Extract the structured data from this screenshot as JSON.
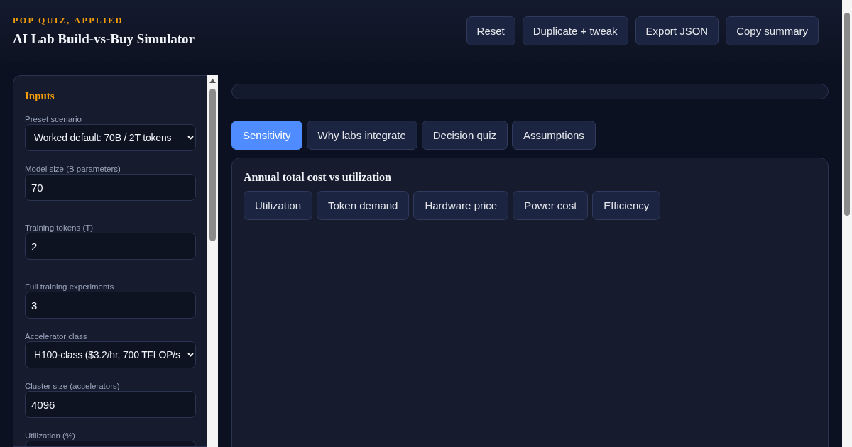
{
  "header": {
    "eyebrow": "POP QUIZ, APPLIED",
    "title": "AI Lab Build-vs-Buy Simulator",
    "actions": [
      "Reset",
      "Duplicate + tweak",
      "Export JSON",
      "Copy summary"
    ]
  },
  "inputs": {
    "title": "Inputs",
    "fields": [
      {
        "kind": "select",
        "label": "Preset scenario",
        "value": "Worked default: 70B / 2T tokens"
      },
      {
        "kind": "number",
        "label": "Model size (B parameters)",
        "value": "70"
      },
      {
        "kind": "number",
        "label": "Training tokens (T)",
        "value": "2"
      },
      {
        "kind": "number",
        "label": "Full training experiments",
        "value": "3"
      },
      {
        "kind": "select",
        "label": "Accelerator class",
        "value": "H100-class ($3.2/hr, 700 TFLOP/s"
      },
      {
        "kind": "number",
        "label": "Cluster size (accelerators)",
        "value": "4096"
      },
      {
        "kind": "number",
        "label": "Utilization (%)"
      }
    ]
  },
  "progress": {
    "level": 0
  },
  "tabs": [
    {
      "label": "Sensitivity",
      "selected": true
    },
    {
      "label": "Why labs integrate",
      "selected": false
    },
    {
      "label": "Decision quiz",
      "selected": false
    },
    {
      "label": "Assumptions",
      "selected": false
    }
  ],
  "panel": {
    "title": "Annual total cost vs utilization",
    "chips": [
      {
        "label": "Utilization",
        "selected": false
      },
      {
        "label": "Token demand",
        "selected": false
      },
      {
        "label": "Hardware price",
        "selected": false
      },
      {
        "label": "Power cost",
        "selected": false
      },
      {
        "label": "Efficiency",
        "selected": false
      }
    ]
  }
}
